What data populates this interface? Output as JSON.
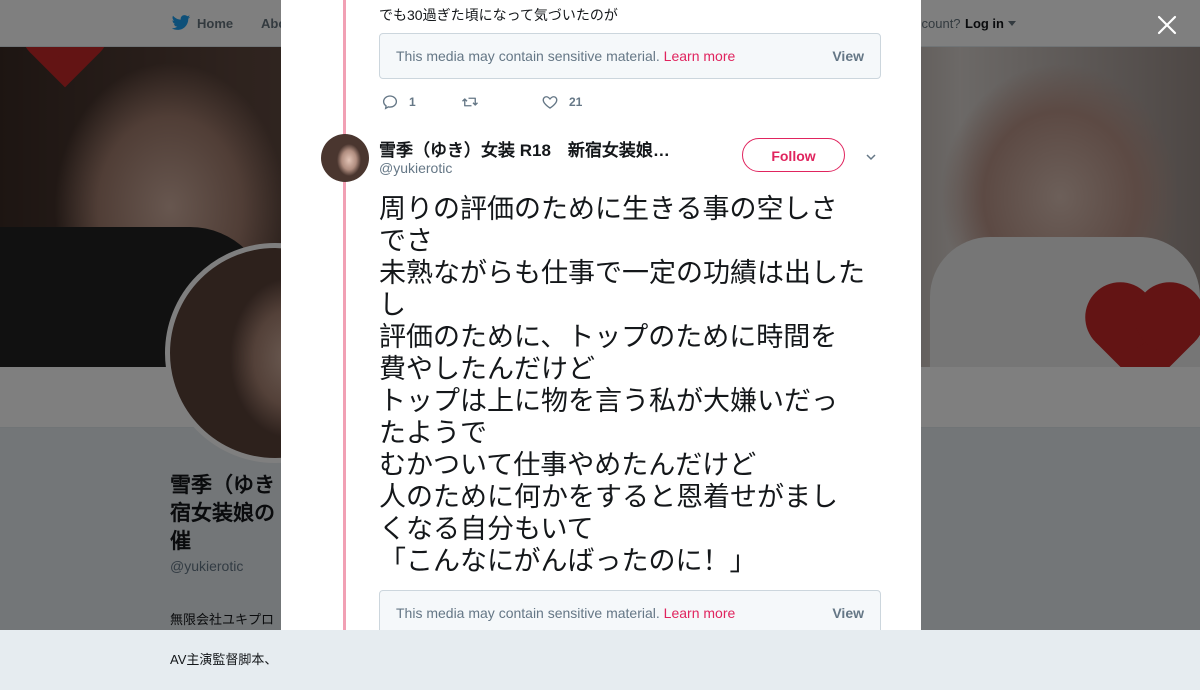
{
  "background": {
    "nav": {
      "home_label": "Home",
      "about_label": "Abo",
      "account_text": "ccount?",
      "login_label": "Log in"
    },
    "profile": {
      "name_lines": [
        "雪季（ゆき",
        "宿女装娘の",
        "催"
      ],
      "handle": "@yukierotic",
      "bio_lines": [
        "無限会社ユキプロ",
        "AV主演監督脚本、"
      ]
    }
  },
  "modal": {
    "previous_tweet": {
      "text_tail": "でも30過ぎた頃になって気づいたのが",
      "sensitive_notice": {
        "message": "This media may contain sensitive material.",
        "learn_more": "Learn more",
        "view": "View"
      },
      "actions": {
        "reply_icon": "reply-icon",
        "reply_count": "1",
        "retweet_icon": "retweet-icon",
        "retweet_count": "",
        "like_icon": "heart-icon",
        "like_count": "21"
      }
    },
    "tweet": {
      "author_name": "雪季（ゆき）女装 R18　新宿女装娘…",
      "author_handle": "@yukierotic",
      "follow_label": "Follow",
      "menu_icon": "chevron-down-icon",
      "text_lines": [
        "周りの評価のために生きる事の空しさ",
        "でさ",
        "未熟ながらも仕事で一定の功績は出した",
        "し",
        "評価のために、トップのために時間を",
        "費やしたんだけど",
        "トップは上に物を言う私が大嫌いだっ",
        "たようで",
        "むかついて仕事やめたんだけど",
        "人のために何かをすると恩着せがまし",
        "くなる自分もいて",
        "「こんなにがんばったのに！」"
      ],
      "sensitive_notice": {
        "message": "This media may contain sensitive material.",
        "learn_more": "Learn more",
        "view": "View"
      }
    },
    "close_icon": "close-icon"
  },
  "colors": {
    "thread_line": "#f1a0b4",
    "follow_accent": "#e0245e",
    "learn_more": "#e0245e",
    "twitter_blue": "#1da1f2"
  }
}
